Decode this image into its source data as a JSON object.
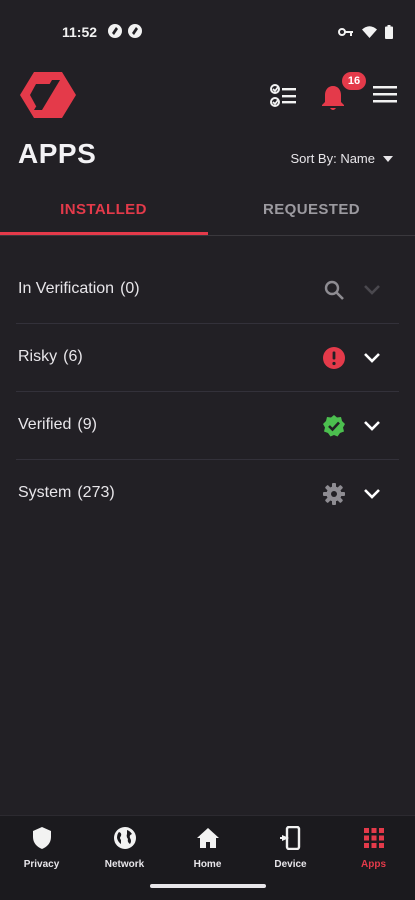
{
  "status_bar": {
    "time": "11:52",
    "left_icons": [
      "app-notification-icon",
      "app-notification-icon"
    ],
    "right_icons": [
      "vpn-key-icon",
      "wifi-icon",
      "battery-icon"
    ]
  },
  "header": {
    "logo": "zimperium-logo",
    "notification_count": "16"
  },
  "page": {
    "title": "APPS",
    "sort_by": "Sort By: Name"
  },
  "tabs": [
    {
      "label": "INSTALLED",
      "active": true
    },
    {
      "label": "REQUESTED",
      "active": false
    }
  ],
  "categories": [
    {
      "label": "In Verification",
      "count": "(0)",
      "icon": "search-icon",
      "icon_color": "#8e8c92",
      "chevron_color": "#4a484e"
    },
    {
      "label": "Risky",
      "count": "(6)",
      "icon": "alert-icon",
      "icon_color": "#e43a4a",
      "chevron_color": "#ffffff"
    },
    {
      "label": "Verified",
      "count": "(9)",
      "icon": "verified-check-icon",
      "icon_color": "#4cbf4f",
      "chevron_color": "#ffffff"
    },
    {
      "label": "System",
      "count": "(273)",
      "icon": "gear-icon",
      "icon_color": "#8e8c92",
      "chevron_color": "#ffffff"
    }
  ],
  "bottom_nav": [
    {
      "label": "Privacy",
      "icon": "shield-icon",
      "active": false
    },
    {
      "label": "Network",
      "icon": "globe-icon",
      "active": false
    },
    {
      "label": "Home",
      "icon": "home-icon",
      "active": false
    },
    {
      "label": "Device",
      "icon": "device-icon",
      "active": false
    },
    {
      "label": "Apps",
      "icon": "apps-grid-icon",
      "active": true
    }
  ],
  "colors": {
    "accent": "#e43a4a",
    "background": "#222025",
    "nav_background": "#1b1a1e",
    "verified": "#4cbf4f"
  }
}
